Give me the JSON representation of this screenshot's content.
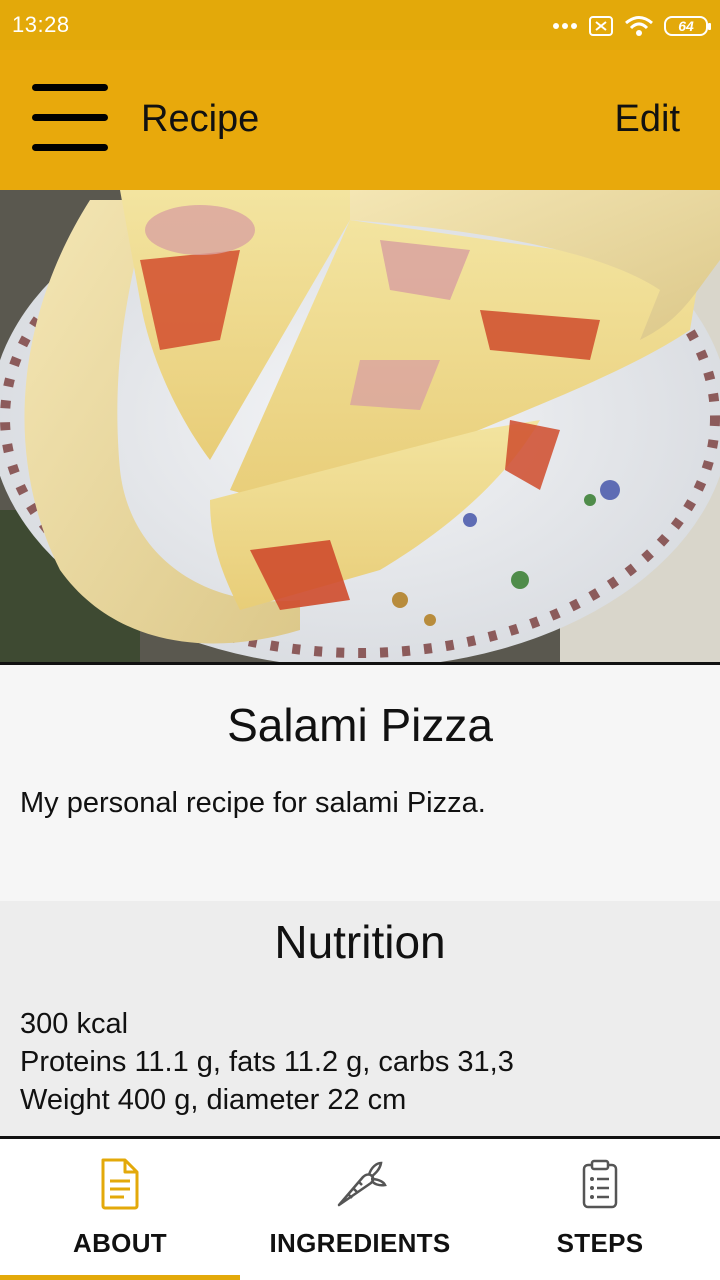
{
  "status_bar": {
    "time": "13:28",
    "battery": "64"
  },
  "app_bar": {
    "title": "Recipe",
    "edit_label": "Edit"
  },
  "recipe": {
    "name": "Salami Pizza",
    "description": "My personal recipe for salami Pizza."
  },
  "nutrition": {
    "heading": "Nutrition",
    "calories": "300 kcal",
    "macros": "Proteins 11.1 g, fats 11.2 g, carbs 31,3",
    "weight": "Weight 400 g, diameter 22 cm"
  },
  "tabs": [
    {
      "label": "ABOUT",
      "icon": "document-icon",
      "active": true
    },
    {
      "label": "INGREDIENTS",
      "icon": "carrot-icon",
      "active": false
    },
    {
      "label": "STEPS",
      "icon": "clipboard-list-icon",
      "active": false
    }
  ],
  "colors": {
    "accent": "#e8a90c",
    "active_tab_icon": "#e3a90a",
    "inactive_tab_icon": "#555555"
  }
}
